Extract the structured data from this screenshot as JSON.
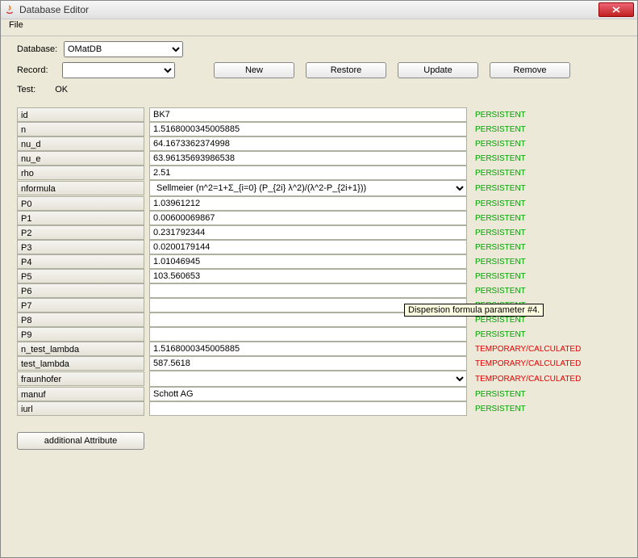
{
  "window": {
    "title": "Database Editor"
  },
  "menu": {
    "file": "File"
  },
  "top": {
    "database_label": "Database:",
    "database_value": "OMatDB",
    "record_label": "Record:",
    "record_value": "",
    "new_btn": "New",
    "restore_btn": "Restore",
    "update_btn": "Update",
    "remove_btn": "Remove",
    "test_label": "Test:",
    "test_value": "OK"
  },
  "status": {
    "persistent": "PERSISTENT",
    "temporary": "TEMPORARY/CALCULATED"
  },
  "tooltip": "Dispersion formula parameter #4.",
  "rows": [
    {
      "name": "id",
      "value": "BK7",
      "type": "text",
      "status": "persistent"
    },
    {
      "name": "n",
      "value": "1.5168000345005885",
      "type": "text",
      "status": "persistent"
    },
    {
      "name": "nu_d",
      "value": "64.1673362374998",
      "type": "text",
      "status": "persistent"
    },
    {
      "name": "nu_e",
      "value": "63.96135693986538",
      "type": "text",
      "status": "persistent"
    },
    {
      "name": "rho",
      "value": "2.51",
      "type": "text",
      "status": "persistent"
    },
    {
      "name": "nformula",
      "value": "Sellmeier (n^2=1+Σ_{i=0} (P_{2i} λ^2)/(λ^2-P_{2i+1}))",
      "type": "select",
      "status": "persistent"
    },
    {
      "name": "P0",
      "value": "1.03961212",
      "type": "text",
      "status": "persistent"
    },
    {
      "name": "P1",
      "value": "0.00600069867",
      "type": "text",
      "status": "persistent"
    },
    {
      "name": "P2",
      "value": "0.231792344",
      "type": "text",
      "status": "persistent"
    },
    {
      "name": "P3",
      "value": "0.0200179144",
      "type": "text",
      "status": "persistent"
    },
    {
      "name": "P4",
      "value": "1.01046945",
      "type": "text",
      "status": "persistent"
    },
    {
      "name": "P5",
      "value": "103.560653",
      "type": "text",
      "status": "persistent"
    },
    {
      "name": "P6",
      "value": "",
      "type": "text",
      "status": "persistent"
    },
    {
      "name": "P7",
      "value": "",
      "type": "text",
      "status": "persistent"
    },
    {
      "name": "P8",
      "value": "",
      "type": "text",
      "status": "persistent"
    },
    {
      "name": "P9",
      "value": "",
      "type": "text",
      "status": "persistent"
    },
    {
      "name": "n_test_lambda",
      "value": "1.5168000345005885",
      "type": "text",
      "status": "temporary"
    },
    {
      "name": "test_lambda",
      "value": "587.5618",
      "type": "text",
      "status": "temporary"
    },
    {
      "name": "fraunhofer",
      "value": "",
      "type": "select",
      "status": "temporary"
    },
    {
      "name": "manuf",
      "value": "Schott AG",
      "type": "text",
      "status": "persistent"
    },
    {
      "name": "iurl",
      "value": "",
      "type": "text",
      "status": "persistent"
    }
  ],
  "buttons": {
    "additional_attribute": "additional Attribute"
  }
}
